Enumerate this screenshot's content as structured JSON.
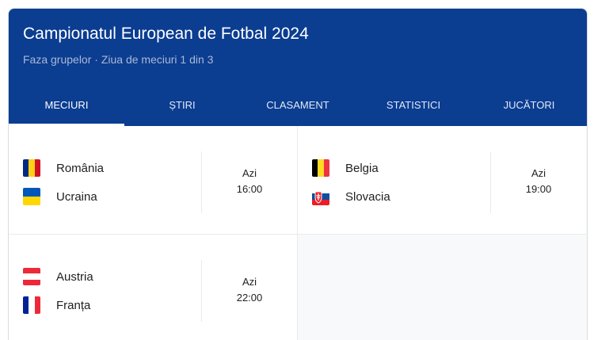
{
  "header": {
    "title": "Campionatul European de Fotbal 2024",
    "subtitle": "Faza grupelor · Ziua de meciuri 1 din 3"
  },
  "tabs": [
    "MECIURI",
    "ȘTIRI",
    "CLASAMENT",
    "STATISTICI",
    "JUCĂTORI"
  ],
  "matches": [
    {
      "home": {
        "name": "România",
        "flag": "romania-flag-icon"
      },
      "away": {
        "name": "Ucraina",
        "flag": "ukraine-flag-icon"
      },
      "day": "Azi",
      "time": "16:00"
    },
    {
      "home": {
        "name": "Belgia",
        "flag": "belgium-flag-icon"
      },
      "away": {
        "name": "Slovacia",
        "flag": "slovakia-flag-icon"
      },
      "day": "Azi",
      "time": "19:00"
    },
    {
      "home": {
        "name": "Austria",
        "flag": "austria-flag-icon"
      },
      "away": {
        "name": "Franța",
        "flag": "france-flag-icon"
      },
      "day": "Azi",
      "time": "22:00"
    }
  ],
  "colors": {
    "header_bg": "#0b3d91",
    "accent": "#ffffff"
  }
}
